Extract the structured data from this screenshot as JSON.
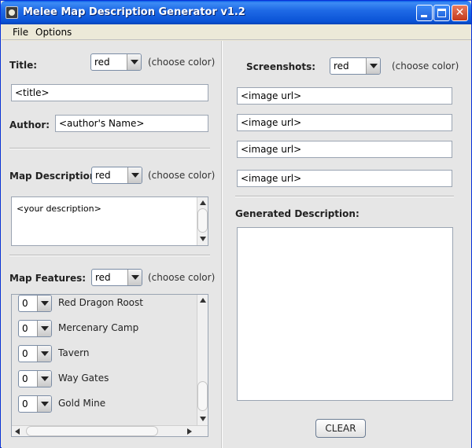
{
  "window": {
    "title": "Melee Map Description Generator v1.2"
  },
  "menu": {
    "items": [
      "File",
      "Options"
    ]
  },
  "left": {
    "title_label": "Title:",
    "title_color": "red",
    "choose_color": "(choose color)",
    "title_input": "<title>",
    "author_label": "Author:",
    "author_input": "<author's Name>",
    "description_label": "Map Description:",
    "description_color": "red",
    "description_text": "<your description>",
    "features_label": "Map Features:",
    "features_color": "red",
    "features": [
      {
        "count": "0",
        "name": "Red Dragon Roost"
      },
      {
        "count": "0",
        "name": "Mercenary Camp"
      },
      {
        "count": "0",
        "name": "Tavern"
      },
      {
        "count": "0",
        "name": "Way Gates"
      },
      {
        "count": "0",
        "name": "Gold Mine"
      }
    ]
  },
  "right": {
    "screenshots_label": "Screenshots:",
    "screenshots_color": "red",
    "choose_color": "(choose color)",
    "image_urls": [
      "<image url>",
      "<image url>",
      "<image url>",
      "<image url>"
    ],
    "generated_label": "Generated Description:",
    "generated_text": "",
    "clear_label": "CLEAR"
  },
  "colors": {
    "titlebar": "#0a53d6",
    "close_button": "#c4391a",
    "panel_bg": "#e6e6e6"
  }
}
